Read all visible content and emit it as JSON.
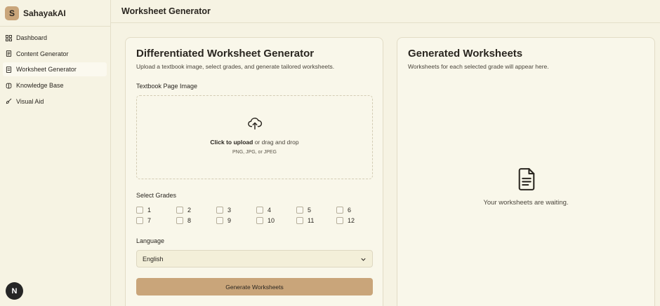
{
  "brand": {
    "logo_letter": "S",
    "name": "SahayakAI"
  },
  "sidebar": {
    "items": [
      {
        "label": "Dashboard",
        "icon": "grid-icon",
        "active": false
      },
      {
        "label": "Content Generator",
        "icon": "document-icon",
        "active": false
      },
      {
        "label": "Worksheet Generator",
        "icon": "worksheet-icon",
        "active": true
      },
      {
        "label": "Knowledge Base",
        "icon": "brain-icon",
        "active": false
      },
      {
        "label": "Visual Aid",
        "icon": "brush-icon",
        "active": false
      }
    ]
  },
  "user": {
    "avatar_letter": "N"
  },
  "header": {
    "title": "Worksheet Generator"
  },
  "form": {
    "title": "Differentiated Worksheet Generator",
    "subtitle": "Upload a textbook image, select grades, and generate tailored worksheets.",
    "upload_label": "Textbook Page Image",
    "upload_cta": "Click to upload",
    "upload_rest": " or drag and drop",
    "upload_hint": "PNG, JPG, or JPEG",
    "grades_label": "Select Grades",
    "grades": [
      "1",
      "2",
      "3",
      "4",
      "5",
      "6",
      "7",
      "8",
      "9",
      "10",
      "11",
      "12"
    ],
    "language_label": "Language",
    "language_value": "English",
    "submit_label": "Generate Worksheets"
  },
  "results": {
    "title": "Generated Worksheets",
    "subtitle": "Worksheets for each selected grade will appear here.",
    "empty_text": "Your worksheets are waiting."
  },
  "colors": {
    "accent": "#c9a57a",
    "background": "#f6f3e3",
    "card": "#f9f7ea"
  }
}
